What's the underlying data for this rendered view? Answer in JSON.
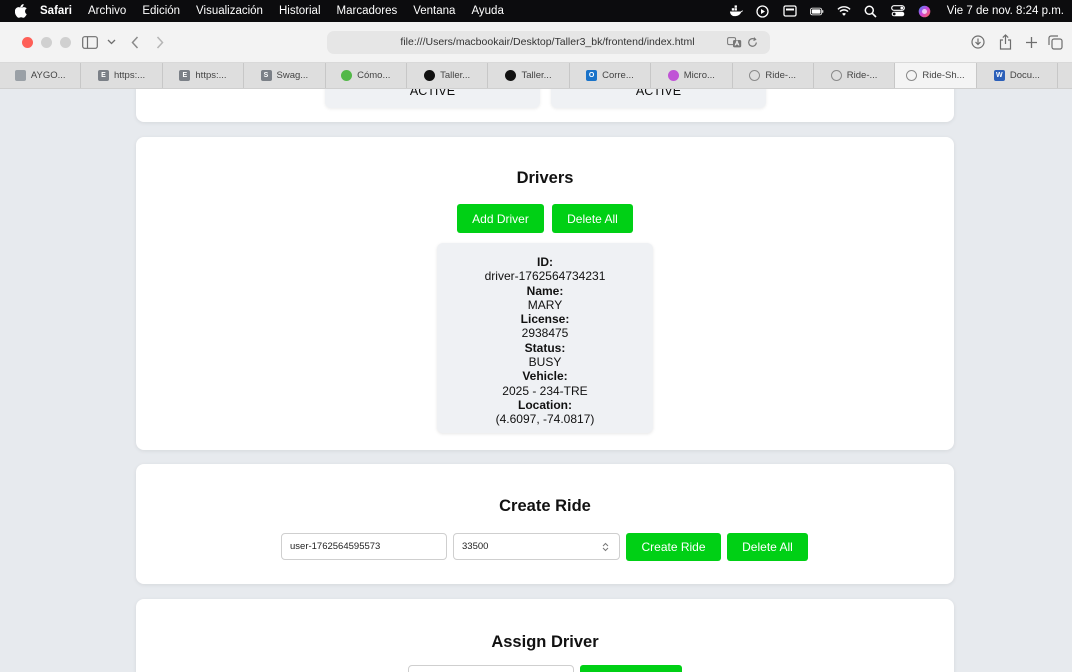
{
  "menubar": {
    "app": "Safari",
    "items": [
      "Archivo",
      "Edición",
      "Visualización",
      "Historial",
      "Marcadores",
      "Ventana",
      "Ayuda"
    ],
    "clock": "Vie 7 de nov. 8:24 p.m."
  },
  "address": {
    "url": "file:///Users/macbookair/Desktop/Taller3_bk/frontend/index.html"
  },
  "tabs": [
    {
      "label": "AYGO...",
      "icon": "document-icon",
      "color": "#9aa0a6"
    },
    {
      "label": "https:...",
      "icon": "e-icon",
      "color": "#7b8087"
    },
    {
      "label": "https:...",
      "icon": "e-icon",
      "color": "#7b8087"
    },
    {
      "label": "Swag...",
      "icon": "swagger-icon",
      "color": "#7b8087"
    },
    {
      "label": "Cómo...",
      "icon": "chatgpt-icon",
      "color": "#53b848"
    },
    {
      "label": "Taller...",
      "icon": "github-icon",
      "color": "#111111"
    },
    {
      "label": "Taller...",
      "icon": "github-icon",
      "color": "#111111"
    },
    {
      "label": "Corre...",
      "icon": "outlook-icon",
      "color": "#1a73c9"
    },
    {
      "label": "Micro...",
      "icon": "copilot-icon",
      "color": "#c054d6"
    },
    {
      "label": "Ride-...",
      "icon": "compass-icon",
      "color": "#8a8a8a"
    },
    {
      "label": "Ride-...",
      "icon": "compass-icon",
      "color": "#8a8a8a"
    },
    {
      "label": "Ride-Sh...",
      "icon": "compass-icon",
      "color": "#8a8a8a",
      "active": true
    },
    {
      "label": "Docu...",
      "icon": "word-icon",
      "color": "#2b5fb9"
    }
  ],
  "passenger_status": [
    "ACTIVE",
    "ACTIVE"
  ],
  "drivers": {
    "title": "Drivers",
    "add_label": "Add Driver",
    "delete_label": "Delete All",
    "driver": {
      "id_label": "ID:",
      "id": "driver-1762564734231",
      "name_label": "Name:",
      "name": "MARY",
      "license_label": "License:",
      "license": "2938475",
      "status_label": "Status:",
      "status": "BUSY",
      "vehicle_label": "Vehicle:",
      "vehicle": "2025 - 234-TRE",
      "location_label": "Location:",
      "location": "(4.6097, -74.0817)"
    }
  },
  "create_ride": {
    "title": "Create Ride",
    "user_value": "user-1762564595573",
    "amount_value": "33500",
    "create_label": "Create Ride",
    "delete_label": "Delete All"
  },
  "assign_driver": {
    "title": "Assign Driver"
  },
  "colors": {
    "accent": "#00d015",
    "page_bg": "#e7eaee"
  }
}
